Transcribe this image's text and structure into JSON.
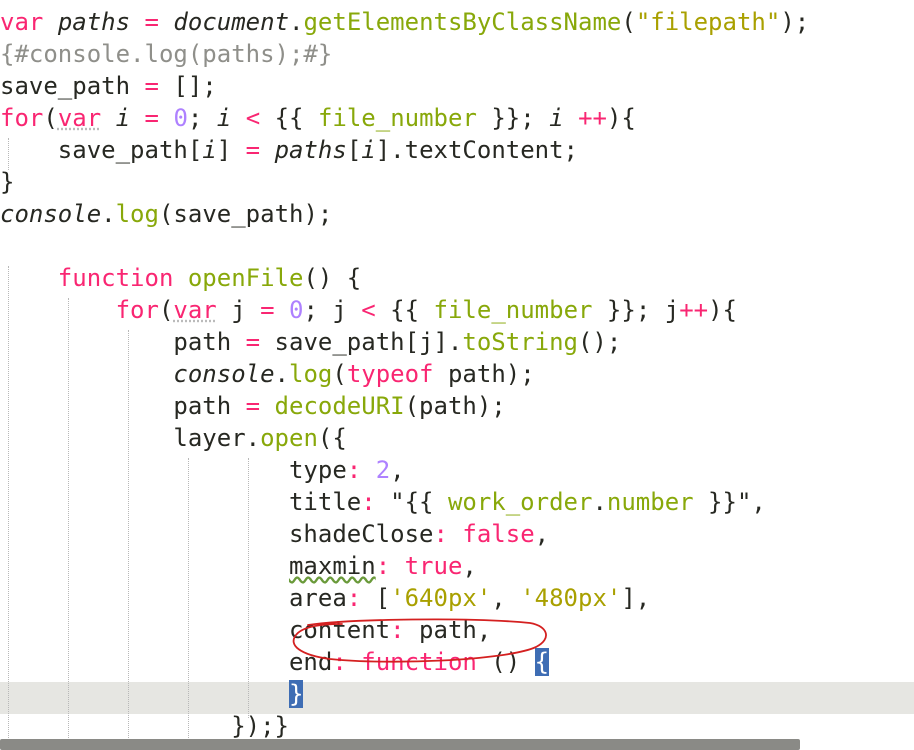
{
  "colors": {
    "keyword": "#f92672",
    "function": "#88a80a",
    "string": "#a9a000",
    "number": "#ae81ff",
    "comment": "#8f8f8a",
    "text": "#272822",
    "punct": "#f92672",
    "bracket_highlight": "#3e6db4",
    "current_line": "#e6e6e2",
    "annotation": "#d42020"
  },
  "code": {
    "lines": [
      [
        {
          "t": "var",
          "c": "keyword"
        },
        {
          "t": " "
        },
        {
          "t": "paths",
          "c": "italic"
        },
        {
          "t": " "
        },
        {
          "t": "=",
          "c": "punct"
        },
        {
          "t": " "
        },
        {
          "t": "document",
          "c": "italic"
        },
        {
          "t": "."
        },
        {
          "t": "getElementsByClassName",
          "c": "function"
        },
        {
          "t": "("
        },
        {
          "t": "\"filepath\"",
          "c": "string"
        },
        {
          "t": ");"
        }
      ],
      [
        {
          "t": "{#console.log(paths);#}",
          "c": "comment"
        }
      ],
      [
        {
          "t": "save_path "
        },
        {
          "t": "=",
          "c": "punct"
        },
        {
          "t": " [];"
        }
      ],
      [
        {
          "t": "for",
          "c": "keyword"
        },
        {
          "t": "("
        },
        {
          "t": "var",
          "c": "keyword_ul"
        },
        {
          "t": " "
        },
        {
          "t": "i",
          "c": "italic"
        },
        {
          "t": " "
        },
        {
          "t": "=",
          "c": "punct"
        },
        {
          "t": " "
        },
        {
          "t": "0",
          "c": "number"
        },
        {
          "t": "; "
        },
        {
          "t": "i",
          "c": "italic"
        },
        {
          "t": " "
        },
        {
          "t": "<",
          "c": "punct"
        },
        {
          "t": " {{ "
        },
        {
          "t": "file_number",
          "c": "function"
        },
        {
          "t": " }}; "
        },
        {
          "t": "i",
          "c": "italic"
        },
        {
          "t": " "
        },
        {
          "t": "++",
          "c": "punct"
        },
        {
          "t": "){"
        }
      ],
      [
        {
          "t": "    save_path["
        },
        {
          "t": "i",
          "c": "italic"
        },
        {
          "t": "] "
        },
        {
          "t": "=",
          "c": "punct"
        },
        {
          "t": " "
        },
        {
          "t": "paths",
          "c": "italic"
        },
        {
          "t": "["
        },
        {
          "t": "i",
          "c": "italic"
        },
        {
          "t": "].textContent;"
        }
      ],
      [
        {
          "t": "}"
        }
      ],
      [
        {
          "t": "console",
          "c": "italic"
        },
        {
          "t": "."
        },
        {
          "t": "log",
          "c": "function"
        },
        {
          "t": "(save_path);"
        }
      ],
      [],
      [
        {
          "t": "    "
        },
        {
          "t": "function",
          "c": "keyword"
        },
        {
          "t": " "
        },
        {
          "t": "openFile",
          "c": "function"
        },
        {
          "t": "() {"
        }
      ],
      [
        {
          "t": "        "
        },
        {
          "t": "for",
          "c": "keyword"
        },
        {
          "t": "("
        },
        {
          "t": "var",
          "c": "keyword_ul"
        },
        {
          "t": " j "
        },
        {
          "t": "=",
          "c": "punct"
        },
        {
          "t": " "
        },
        {
          "t": "0",
          "c": "number"
        },
        {
          "t": "; j "
        },
        {
          "t": "<",
          "c": "punct"
        },
        {
          "t": " {{ "
        },
        {
          "t": "file_number",
          "c": "function"
        },
        {
          "t": " }}; j"
        },
        {
          "t": "++",
          "c": "punct"
        },
        {
          "t": "){"
        }
      ],
      [
        {
          "t": "            path "
        },
        {
          "t": "=",
          "c": "punct"
        },
        {
          "t": " save_path[j]."
        },
        {
          "t": "toString",
          "c": "function"
        },
        {
          "t": "();"
        }
      ],
      [
        {
          "t": "            "
        },
        {
          "t": "console",
          "c": "italic"
        },
        {
          "t": "."
        },
        {
          "t": "log",
          "c": "function"
        },
        {
          "t": "("
        },
        {
          "t": "typeof",
          "c": "keyword"
        },
        {
          "t": " path);"
        }
      ],
      [
        {
          "t": "            path "
        },
        {
          "t": "=",
          "c": "punct"
        },
        {
          "t": " "
        },
        {
          "t": "decodeURI",
          "c": "function"
        },
        {
          "t": "(path);"
        }
      ],
      [
        {
          "t": "            layer."
        },
        {
          "t": "open",
          "c": "function"
        },
        {
          "t": "({"
        }
      ],
      [
        {
          "t": "                    type"
        },
        {
          "t": ":",
          "c": "punct"
        },
        {
          "t": " "
        },
        {
          "t": "2",
          "c": "number"
        },
        {
          "t": ","
        }
      ],
      [
        {
          "t": "                    title"
        },
        {
          "t": ":",
          "c": "punct"
        },
        {
          "t": " \"{{ "
        },
        {
          "t": "work_order",
          "c": "function"
        },
        {
          "t": "."
        },
        {
          "t": "number",
          "c": "function"
        },
        {
          "t": " }}\","
        }
      ],
      [
        {
          "t": "                    shadeClose"
        },
        {
          "t": ":",
          "c": "punct"
        },
        {
          "t": " "
        },
        {
          "t": "false",
          "c": "keyword"
        },
        {
          "t": ","
        }
      ],
      [
        {
          "t": "                    "
        },
        {
          "t": "maxmin",
          "c": "squiggle"
        },
        {
          "t": ":",
          "c": "punct"
        },
        {
          "t": " "
        },
        {
          "t": "true",
          "c": "keyword"
        },
        {
          "t": ","
        }
      ],
      [
        {
          "t": "                    area"
        },
        {
          "t": ":",
          "c": "punct"
        },
        {
          "t": " ["
        },
        {
          "t": "'640px'",
          "c": "string"
        },
        {
          "t": ", "
        },
        {
          "t": "'480px'",
          "c": "string"
        },
        {
          "t": "],"
        }
      ],
      [
        {
          "t": "                    content"
        },
        {
          "t": ":",
          "c": "punct"
        },
        {
          "t": " path,"
        }
      ],
      [
        {
          "t": "                    end"
        },
        {
          "t": ":",
          "c": "punct"
        },
        {
          "t": " "
        },
        {
          "t": "function",
          "c": "keyword"
        },
        {
          "t": " () "
        },
        {
          "t": "{",
          "c": "bracket"
        }
      ],
      [
        {
          "t": "                    "
        },
        {
          "t": "}",
          "c": "bracket"
        }
      ],
      [
        {
          "t": "                "
        },
        {
          "t": "});}"
        }
      ]
    ]
  }
}
